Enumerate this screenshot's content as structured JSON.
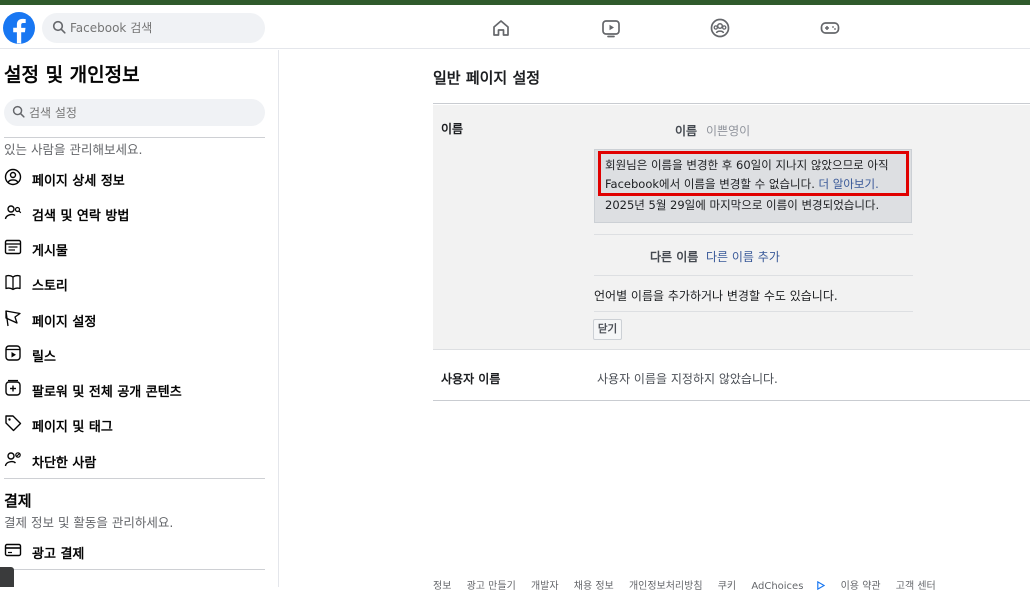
{
  "topbar": {
    "search_placeholder": "Facebook 검색",
    "nav_icons": [
      "home-icon",
      "video-icon",
      "groups-icon",
      "gaming-icon"
    ],
    "brand_color": "#1877f2"
  },
  "sidebar": {
    "title": "설정 및 개인정보",
    "search_placeholder": "검색 설정",
    "section_subtitle": "있는 사람을 관리해보세요.",
    "items": [
      {
        "label": "페이지 상세 정보",
        "icon": "person-circle-icon"
      },
      {
        "label": "검색 및 연락 방법",
        "icon": "person-search-icon"
      },
      {
        "label": "게시물",
        "icon": "posts-icon"
      },
      {
        "label": "스토리",
        "icon": "book-icon"
      },
      {
        "label": "페이지 설정",
        "icon": "flag-icon"
      },
      {
        "label": "릴스",
        "icon": "reels-icon"
      },
      {
        "label": "팔로워 및 전체 공개 콘텐츠",
        "icon": "plus-square-icon"
      },
      {
        "label": "페이지 및 태그",
        "icon": "tag-icon"
      },
      {
        "label": "차단한 사람",
        "icon": "person-block-icon"
      }
    ],
    "payments_heading": "결제",
    "payments_subtitle": "결제 정보 및 활동을 관리하세요.",
    "payment_items": [
      {
        "label": "광고 결제",
        "icon": "card-icon"
      }
    ]
  },
  "main": {
    "title": "일반 페이지 설정",
    "name_section": {
      "label": "이름",
      "name_field_label": "이름",
      "name_value": "이쁜영이",
      "notice_line1": "회원님은 이름을 변경한 후 60일이 지나지 않았으므로 아직",
      "notice_line2_prefix": "Facebook에서 이름을 변경할 수 없습니다. ",
      "notice_link": "더 알아보기.",
      "notice_line3": "2025년 5월 29일에 마지막으로 이름이 변경되었습니다.",
      "other_names_label": "다른 이름",
      "other_names_link": "다른 이름 추가",
      "language_note": "언어별 이름을 추가하거나 변경할 수도 있습니다.",
      "close_label": "닫기"
    },
    "username_section": {
      "label": "사용자 이름",
      "value": "사용자 이름을 지정하지 않았습니다."
    }
  },
  "footer": {
    "links": [
      "정보",
      "광고 만들기",
      "개발자",
      "채용 정보",
      "개인정보처리방침",
      "쿠키",
      "AdChoices",
      "이용 약관",
      "고객 센터"
    ]
  }
}
